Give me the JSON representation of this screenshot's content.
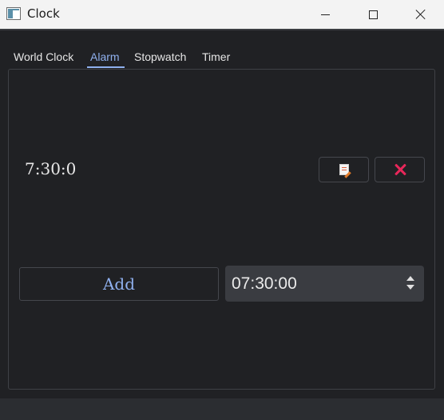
{
  "window": {
    "title": "Clock",
    "icon": "window-app-icon",
    "controls": [
      "minimize-icon",
      "maximize-icon",
      "close-icon"
    ]
  },
  "tabs": [
    {
      "label": "World Clock",
      "selected": false
    },
    {
      "label": "Alarm",
      "selected": true
    },
    {
      "label": "Stopwatch",
      "selected": false
    },
    {
      "label": "Timer",
      "selected": false
    }
  ],
  "alarm": {
    "entry_time": "7:30:0",
    "edit_icon": "edit-document-icon",
    "delete_icon": "delete-x-icon",
    "add_label": "Add",
    "time_value": "07:30:00"
  },
  "colors": {
    "accent": "#8fb0ee",
    "delete": "#e8275a",
    "background": "#202124",
    "titlebar": "#f3f3f3"
  }
}
